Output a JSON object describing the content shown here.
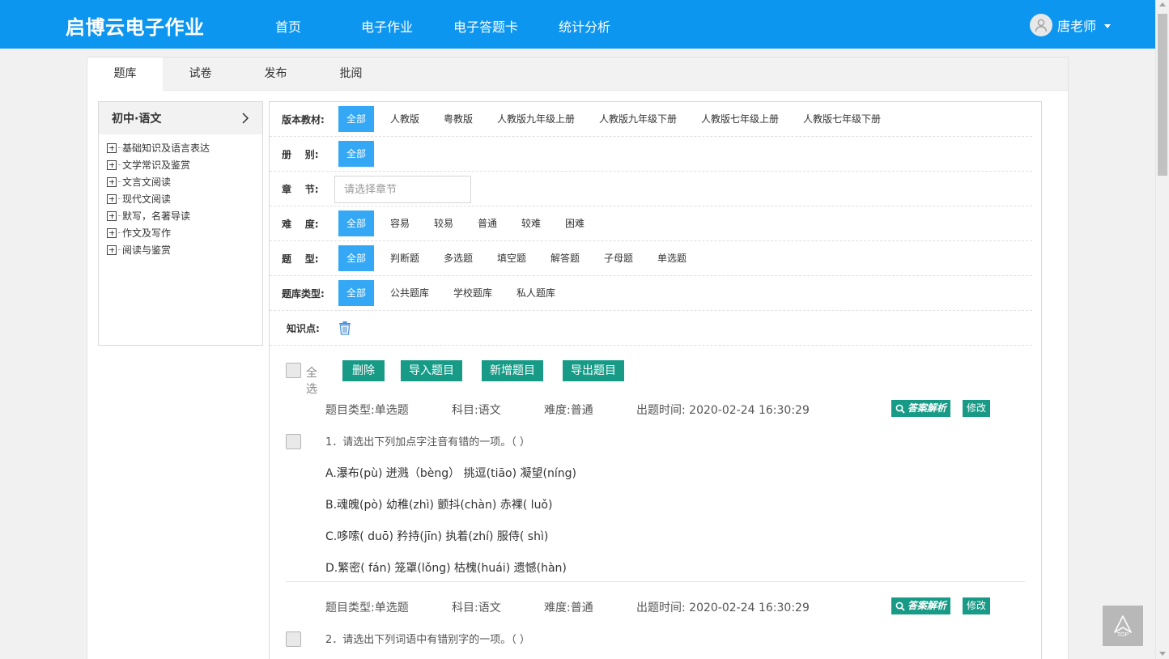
{
  "header": {
    "logo": "启博云电子作业",
    "nav": [
      "首页",
      "电子作业",
      "电子答题卡",
      "统计分析"
    ],
    "user_name": "唐老师"
  },
  "tabs": [
    "题库",
    "试卷",
    "发布",
    "批阅"
  ],
  "tree": {
    "title": "初中·语文",
    "items": [
      "基础知识及语言表达",
      "文学常识及鉴赏",
      "文言文阅读",
      "现代文阅读",
      "默写，名著导读",
      "作文及写作",
      "阅读与鉴赏"
    ]
  },
  "filters": {
    "textbook": {
      "label": "版本教材:",
      "options": [
        "全部",
        "人教版",
        "粤教版",
        "人教版九年级上册",
        "人教版九年级下册",
        "人教版七年级上册",
        "人教版七年级下册"
      ]
    },
    "volume": {
      "label": "册    别:",
      "options": [
        "全部"
      ]
    },
    "chapter": {
      "label": "章    节:",
      "placeholder": "请选择章节"
    },
    "difficulty": {
      "label": "难    度:",
      "options": [
        "全部",
        "容易",
        "较易",
        "普通",
        "较难",
        "困难"
      ]
    },
    "qtype": {
      "label": "题    型:",
      "options": [
        "全部",
        "判断题",
        "多选题",
        "填空题",
        "解答题",
        "子母题",
        "单选题"
      ]
    },
    "bank": {
      "label": "题库类型:",
      "options": [
        "全部",
        "公共题库",
        "学校题库",
        "私人题库"
      ]
    },
    "knowledge": {
      "label": "知识点:"
    }
  },
  "toolbar": {
    "select_all": "全选",
    "delete": "删除",
    "import": "导入题目",
    "add": "新增题目",
    "export": "导出题目"
  },
  "questions": [
    {
      "type": "题目类型:单选题",
      "subject": "科目:语文",
      "difficulty": "难度:普通",
      "time": "出题时间: 2020-02-24 16:30:29",
      "answer_btn": "答案解析",
      "edit_btn": "修改",
      "stem": "1．请选出下列加点字注音有错的一项。（ ）",
      "options": [
        "A.瀑布(pù) 迸溅（bèng） 挑逗(tiāo) 凝望(níng)",
        "B.魂魄(pò) 幼稚(zhì) 颤抖(chàn) 赤裸( luǒ)",
        "C.哆嗦( duō) 矜持(jīn) 执着(zhí) 服侍( shì)",
        "D.繁密( fán) 笼罩(lǒng) 枯槐(huái) 遗憾(hàn)"
      ]
    },
    {
      "type": "题目类型:单选题",
      "subject": "科目:语文",
      "difficulty": "难度:普通",
      "time": "出题时间: 2020-02-24 16:30:29",
      "answer_btn": "答案解析",
      "edit_btn": "修改",
      "stem": "2．请选出下列词语中有错别字的一项。（ ）"
    }
  ],
  "to_top": "TOP",
  "colors": {
    "primary": "#0c96f0",
    "active_option": "#34a7f5",
    "action_green": "#179a86"
  }
}
